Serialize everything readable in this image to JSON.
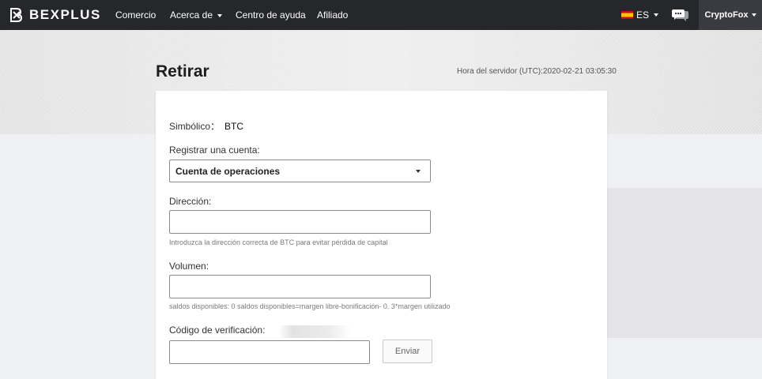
{
  "nav": {
    "brand": "BEXPLUS",
    "items": [
      {
        "label": "Comercio"
      },
      {
        "label": "Acerca de"
      },
      {
        "label": "Centro de ayuda"
      },
      {
        "label": "Afiliado"
      }
    ],
    "language": "ES",
    "user": "CryptoFox"
  },
  "page": {
    "title": "Retirar",
    "server_time": "Hora del servidor (UTC):2020-02-21 03:05:30"
  },
  "form": {
    "symbol_label": "Simbólico：",
    "symbol_value": "BTC",
    "account_label": "Registrar una cuenta:",
    "account_selected": "Cuenta de operaciones",
    "address_label": "Dirección:",
    "address_value": "",
    "address_hint": "Introduzca la dirección correcta de BTC para evitar pérdida de capital",
    "volume_label": "Volumen:",
    "volume_value": "",
    "balance_hint": "saldos disponibles:   0    saldos disponibles=margen libre-bonificación- 0. 3*margen utilizado",
    "code_label": "Código de verificación:",
    "code_value": "",
    "send_button": "Enviar"
  },
  "colors": {
    "navbar": "#25272b",
    "user_tab": "#393b40",
    "page_bg": "#eff0f3",
    "flag_red": "#c60b1e",
    "flag_yellow": "#ffc400"
  },
  "icons": [
    "bexplus-logo-icon",
    "chevron-down-icon",
    "spain-flag-icon",
    "chat-icon"
  ]
}
